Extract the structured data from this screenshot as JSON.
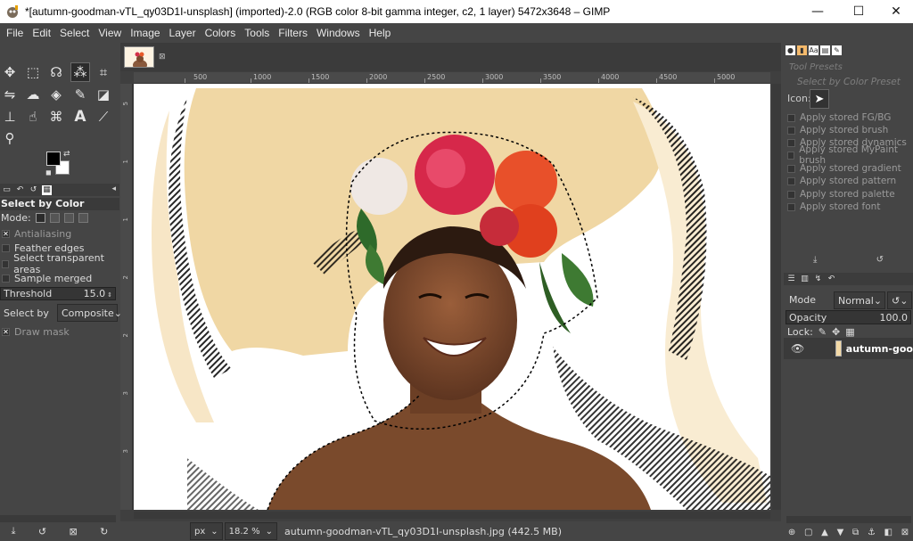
{
  "window": {
    "title": "*[autumn-goodman-vTL_qy03D1I-unsplash] (imported)-2.0 (RGB color 8-bit gamma integer, c2, 1 layer) 5472x3648 – GIMP",
    "minimize": "—",
    "maximize": "☐",
    "close": "✕"
  },
  "menubar": {
    "items": [
      "File",
      "Edit",
      "Select",
      "View",
      "Image",
      "Layer",
      "Colors",
      "Tools",
      "Filters",
      "Windows",
      "Help"
    ]
  },
  "toolbox": {
    "tools": [
      {
        "name": "move-tool-icon",
        "glyph": "✥"
      },
      {
        "name": "rect-select-icon",
        "glyph": "⬚"
      },
      {
        "name": "lasso-icon",
        "glyph": "☊"
      },
      {
        "name": "select-by-color-icon",
        "glyph": "⁂"
      },
      {
        "name": "crop-icon",
        "glyph": "⌗"
      },
      {
        "name": "transform-icon",
        "glyph": "⇋"
      },
      {
        "name": "warp-icon",
        "glyph": "☁"
      },
      {
        "name": "bucket-fill-icon",
        "glyph": "◈"
      },
      {
        "name": "paintbrush-icon",
        "glyph": "✎"
      },
      {
        "name": "eraser-icon",
        "glyph": "◪"
      },
      {
        "name": "clone-icon",
        "glyph": "⊥"
      },
      {
        "name": "smudge-icon",
        "glyph": "☝"
      },
      {
        "name": "paths-icon",
        "glyph": "⌘"
      },
      {
        "name": "text-tool-icon",
        "glyph": "A"
      },
      {
        "name": "color-picker-icon",
        "glyph": "⟋"
      },
      {
        "name": "zoom-icon",
        "glyph": "⚲"
      }
    ],
    "fg_color": "#000000",
    "bg_color": "#ffffff"
  },
  "tool_options": {
    "title": "Select by Color",
    "mode_label": "Mode:",
    "antialiasing": "Antialiasing",
    "feather_edges": "Feather edges",
    "select_transparent": "Select transparent areas",
    "sample_merged": "Sample merged",
    "threshold_label": "Threshold",
    "threshold_value": "15.0",
    "select_by_label": "Select by",
    "select_by_value": "Composite",
    "draw_mask": "Draw mask"
  },
  "image_window": {
    "ruler_ticks": [
      "500",
      "1000",
      "1500",
      "2000",
      "2500",
      "3000",
      "3500",
      "4000",
      "4500",
      "5000"
    ],
    "unit": "px",
    "zoom": "18.2 %",
    "status": "autumn-goodman-vTL_qy03D1I-unsplash.jpg (442.5 MB)"
  },
  "right_dock": {
    "panel_title": "Tool Presets",
    "preset_title": "Select by Color Preset",
    "icon_label": "Icon:",
    "presets": [
      "Apply stored FG/BG",
      "Apply stored brush",
      "Apply stored dynamics",
      "Apply stored MyPaint brush",
      "Apply stored gradient",
      "Apply stored pattern",
      "Apply stored palette",
      "Apply stored font"
    ],
    "layers": {
      "mode_label": "Mode",
      "mode_value": "Normal",
      "opacity_label": "Opacity",
      "opacity_value": "100.0",
      "lock_label": "Lock:",
      "layer_name": "autumn-goo"
    }
  },
  "colors": {
    "accent_selection": "#f4b96b",
    "background": "#454545"
  }
}
